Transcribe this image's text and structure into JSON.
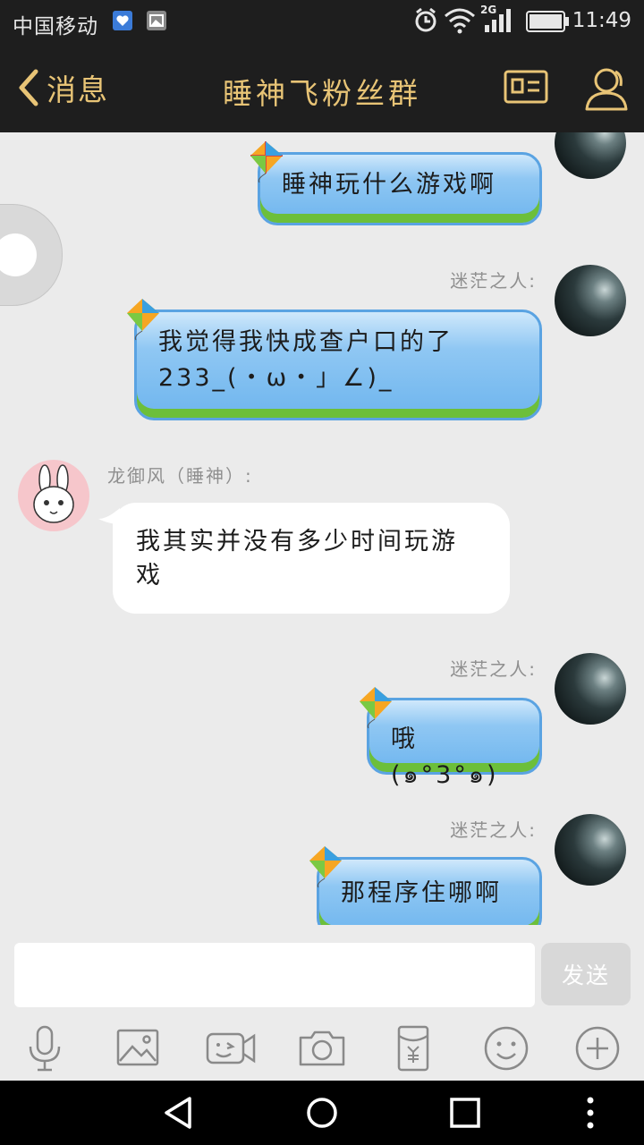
{
  "status_bar": {
    "carrier": "中国移动",
    "network": "2G",
    "time": "11:49"
  },
  "header": {
    "back_label": "消息",
    "title": "睡神飞粉丝群",
    "icons": [
      "group-card-icon",
      "group-members-icon"
    ]
  },
  "messages": [
    {
      "side": "right",
      "sender": "",
      "text": "睡神玩什么游戏啊",
      "style": "kite-bubble"
    },
    {
      "side": "right",
      "sender": "迷茫之人:",
      "text_lines": [
        "我觉得我快成查户口的了",
        "233_(・ω・」∠)_"
      ],
      "style": "kite-bubble"
    },
    {
      "side": "left",
      "sender": "龙御风（睡神）:",
      "text_lines": [
        "我其实并没有多少时间玩游",
        "戏"
      ],
      "style": "white"
    },
    {
      "side": "right",
      "sender": "迷茫之人:",
      "text": "哦(๑°3°๑)",
      "style": "kite-bubble"
    },
    {
      "side": "right",
      "sender": "迷茫之人:",
      "text": "那程序住哪啊",
      "style": "kite-bubble"
    }
  ],
  "input": {
    "value": "",
    "send_label": "发送"
  },
  "toolbar": [
    "microphone-icon",
    "image-icon",
    "video-call-icon",
    "camera-icon",
    "red-packet-icon",
    "emoji-icon",
    "plus-icon"
  ],
  "colors": {
    "header_bg": "#1e1e1e",
    "header_accent": "#e8c476",
    "chat_bg": "#ebebeb",
    "bubble_blue": "#8fc7f3",
    "bubble_grass": "#6cbf3a"
  }
}
